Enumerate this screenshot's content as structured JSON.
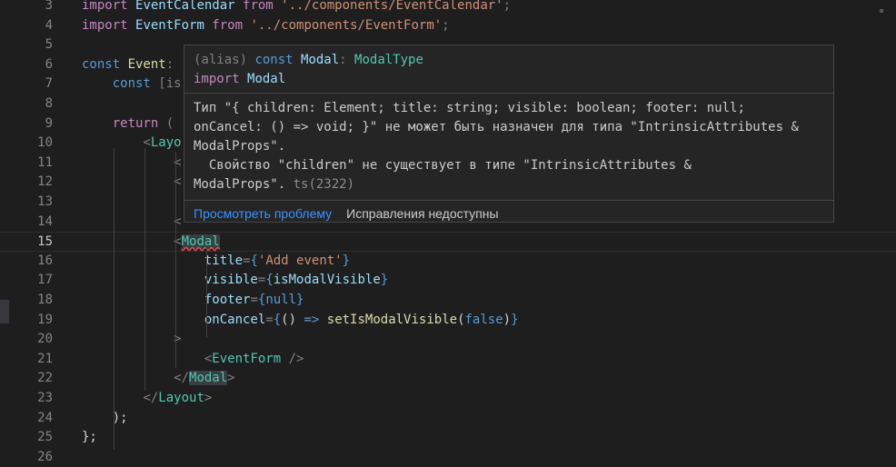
{
  "lines": [
    {
      "n": "3",
      "html_tokens": [
        [
          "kw2",
          "import "
        ],
        [
          "var",
          "EventCalendar"
        ],
        [
          "kw2",
          " from "
        ],
        [
          "str",
          "'../components/EventCalendar'"
        ],
        [
          "punct",
          ";"
        ]
      ]
    },
    {
      "n": "4",
      "html_tokens": [
        [
          "kw2",
          "import "
        ],
        [
          "var",
          "EventForm"
        ],
        [
          "kw2",
          " from "
        ],
        [
          "str",
          "'../components/EventForm'"
        ],
        [
          "punct",
          ";"
        ]
      ]
    },
    {
      "n": "5",
      "html_tokens": []
    },
    {
      "n": "6",
      "html_tokens": [
        [
          "kw",
          "const "
        ],
        [
          "fn",
          "Event"
        ],
        [
          "punct",
          ":"
        ]
      ]
    },
    {
      "n": "7",
      "html_tokens": [
        [
          "plain",
          "    "
        ],
        [
          "kw",
          "const "
        ],
        [
          "punct",
          "[is"
        ]
      ]
    },
    {
      "n": "8",
      "html_tokens": []
    },
    {
      "n": "9",
      "html_tokens": [
        [
          "plain",
          "    "
        ],
        [
          "kw2",
          "return "
        ],
        [
          "punct",
          "("
        ]
      ]
    },
    {
      "n": "10",
      "html_tokens": [
        [
          "plain",
          "        "
        ],
        [
          "punct",
          "<"
        ],
        [
          "tag",
          "Layo"
        ]
      ]
    },
    {
      "n": "11",
      "html_tokens": [
        [
          "plain",
          "            "
        ],
        [
          "punct",
          "<"
        ]
      ]
    },
    {
      "n": "12",
      "html_tokens": [
        [
          "plain",
          "            "
        ],
        [
          "punct",
          "<"
        ]
      ]
    },
    {
      "n": "13",
      "html_tokens": []
    },
    {
      "n": "14",
      "html_tokens": [
        [
          "plain",
          "            "
        ],
        [
          "punct",
          "<"
        ]
      ]
    },
    {
      "n": "15",
      "html_tokens": [
        [
          "plain",
          "            "
        ],
        [
          "punct",
          "<"
        ],
        [
          "modal",
          "Modal"
        ]
      ]
    },
    {
      "n": "16",
      "html_tokens": [
        [
          "plain",
          "                "
        ],
        [
          "attr",
          "title"
        ],
        [
          "punct",
          "="
        ],
        [
          "br",
          "{"
        ],
        [
          "str",
          "'Add event'"
        ],
        [
          "br",
          "}"
        ]
      ]
    },
    {
      "n": "17",
      "html_tokens": [
        [
          "plain",
          "                "
        ],
        [
          "attr",
          "visible"
        ],
        [
          "punct",
          "="
        ],
        [
          "br",
          "{"
        ],
        [
          "var",
          "isModalVisible"
        ],
        [
          "br",
          "}"
        ]
      ]
    },
    {
      "n": "18",
      "html_tokens": [
        [
          "plain",
          "                "
        ],
        [
          "attr",
          "footer"
        ],
        [
          "punct",
          "="
        ],
        [
          "br",
          "{"
        ],
        [
          "kw",
          "null"
        ],
        [
          "br",
          "}"
        ]
      ]
    },
    {
      "n": "19",
      "html_tokens": [
        [
          "plain",
          "                "
        ],
        [
          "attr",
          "onCancel"
        ],
        [
          "punct",
          "="
        ],
        [
          "br",
          "{"
        ],
        [
          "plain",
          "() "
        ],
        [
          "kw",
          "=>"
        ],
        [
          "plain",
          " "
        ],
        [
          "fn",
          "setIsModalVisible"
        ],
        [
          "plain",
          "("
        ],
        [
          "kw",
          "false"
        ],
        [
          "plain",
          ")"
        ],
        [
          "br",
          "}"
        ]
      ]
    },
    {
      "n": "20",
      "html_tokens": [
        [
          "plain",
          "            "
        ],
        [
          "punct",
          ">"
        ]
      ]
    },
    {
      "n": "21",
      "html_tokens": [
        [
          "plain",
          "                "
        ],
        [
          "punct",
          "<"
        ],
        [
          "tag",
          "EventForm"
        ],
        [
          "punct",
          " />"
        ]
      ]
    },
    {
      "n": "22",
      "html_tokens": [
        [
          "plain",
          "            "
        ],
        [
          "punct",
          "</"
        ],
        [
          "tagh",
          "Modal"
        ],
        [
          "punct",
          ">"
        ]
      ]
    },
    {
      "n": "23",
      "html_tokens": [
        [
          "plain",
          "        "
        ],
        [
          "punct",
          "</"
        ],
        [
          "tag",
          "Layout"
        ],
        [
          "punct",
          ">"
        ]
      ]
    },
    {
      "n": "24",
      "html_tokens": [
        [
          "plain",
          "    "
        ],
        [
          "plain",
          ");"
        ]
      ]
    },
    {
      "n": "25",
      "html_tokens": [
        [
          "plain",
          "};"
        ]
      ]
    },
    {
      "n": "26",
      "html_tokens": []
    }
  ],
  "hover": {
    "sig_line1": "(alias) const Modal: ModalType",
    "sig_line2": "import Modal",
    "msg_l1": "Тип \"{ children: Element; title: string; visible: boolean; footer: null;",
    "msg_l2": "onCancel: () => void; }\" не может быть назначен для типа \"IntrinsicAttributes &",
    "msg_l3": "ModalProps\".",
    "msg_l4": "  Свойство \"children\" не существует в типе \"IntrinsicAttributes &",
    "msg_l5": "ModalProps\".",
    "ts_code": "ts(2322)",
    "view_problem": "Просмотреть проблему",
    "no_fixes": "Исправления недоступны"
  },
  "colors": {
    "background": "#1e1e1e",
    "hover_bg": "#252526",
    "link": "#3794ff"
  }
}
